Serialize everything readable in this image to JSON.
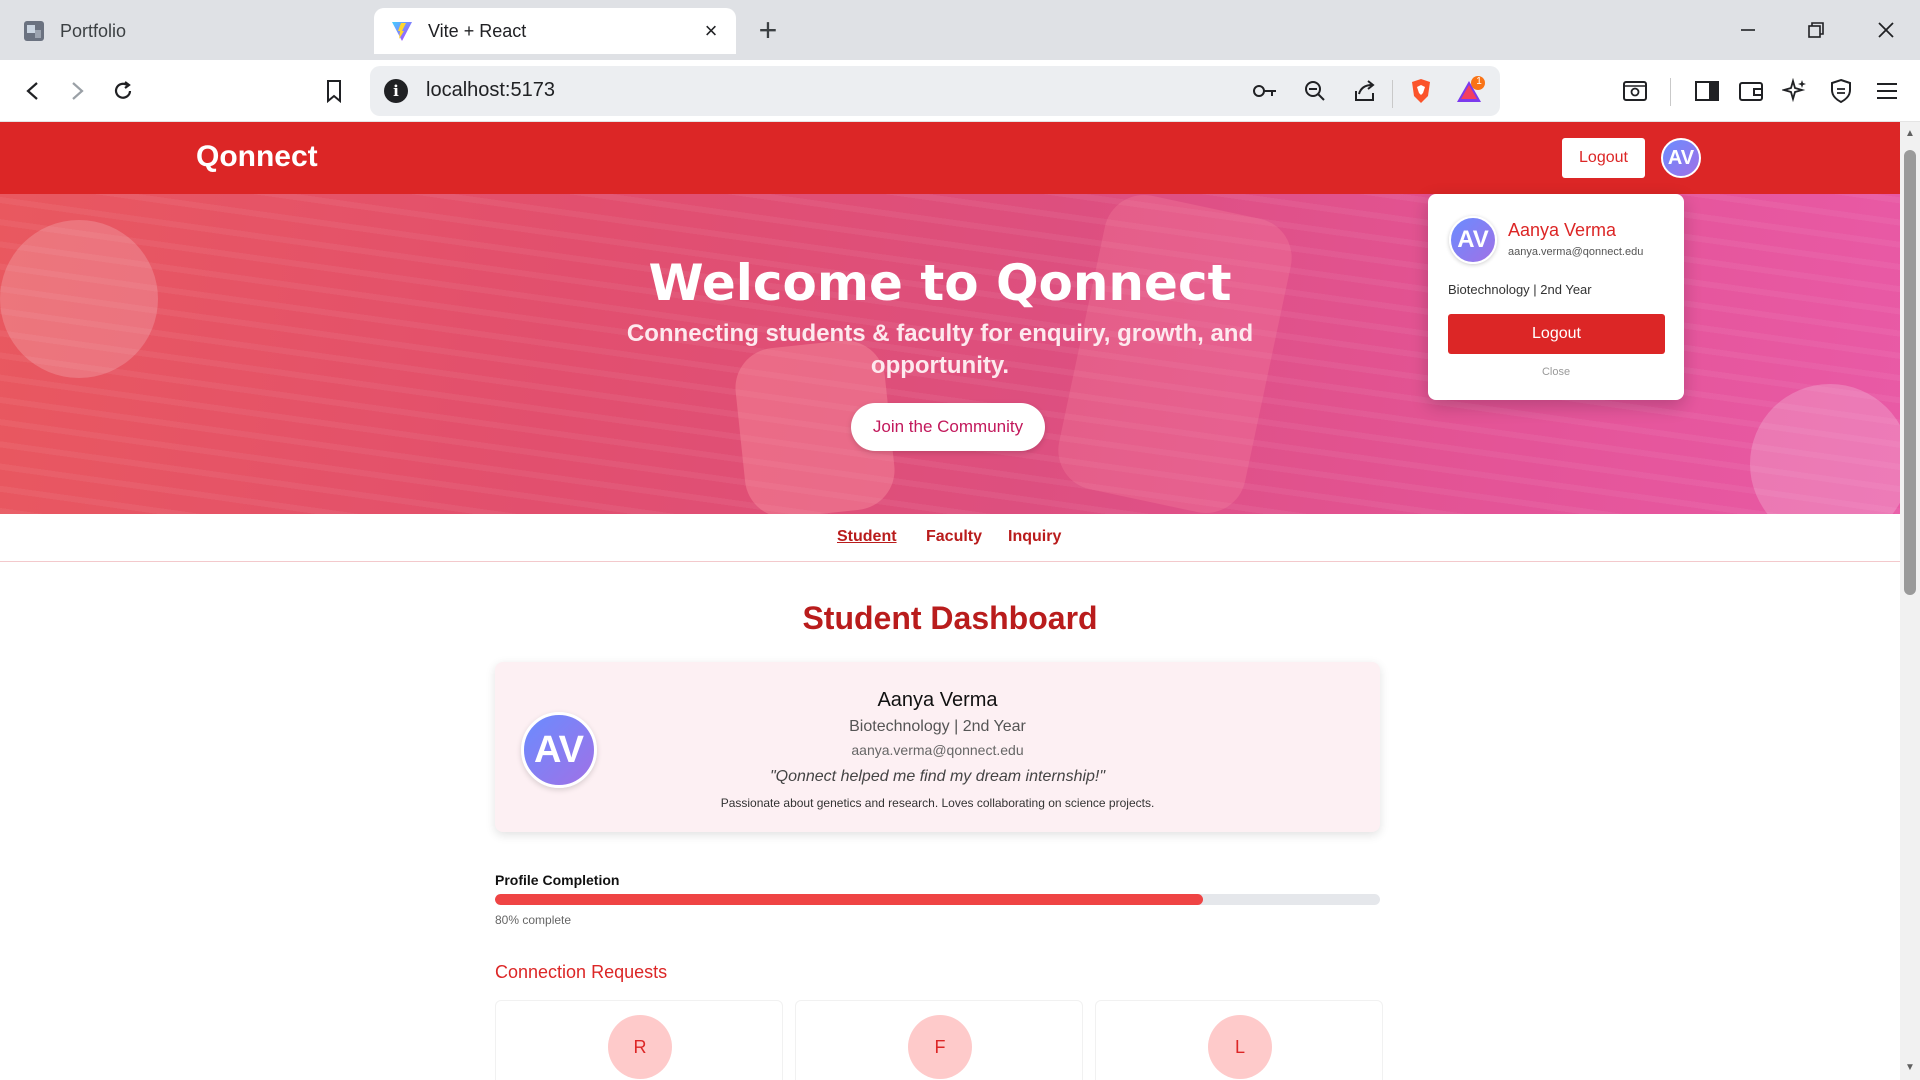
{
  "browser": {
    "tabs": [
      {
        "title": "Portfolio",
        "active": false
      },
      {
        "title": "Vite + React",
        "active": true
      }
    ],
    "url": "localhost:5173",
    "notification_count": "1"
  },
  "site": {
    "logo": "Qonnect",
    "nav_logout": "Logout",
    "avatar_initials": "AV",
    "accent_color": "#dc2626"
  },
  "hero": {
    "title": "Welcome to Qonnect",
    "subtitle": "Connecting students & faculty for enquiry, growth, and opportunity.",
    "cta": "Join the Community"
  },
  "tabs": [
    {
      "label": "Student",
      "active": true
    },
    {
      "label": "Faculty",
      "active": false
    },
    {
      "label": "Inquiry",
      "active": false
    }
  ],
  "dashboard": {
    "title": "Student Dashboard",
    "profile": {
      "initials": "AV",
      "name": "Aanya Verma",
      "dept": "Biotechnology | 2nd Year",
      "email": "aanya.verma@qonnect.edu",
      "quote": "\"Qonnect helped me find my dream internship!\"",
      "bio": "Passionate about genetics and research. Loves collaborating on science projects."
    },
    "completion": {
      "label": "Profile Completion",
      "percent": 80,
      "text": "80% complete"
    },
    "connections": {
      "title": "Connection Requests",
      "items": [
        {
          "initial": "R"
        },
        {
          "initial": "F"
        },
        {
          "initial": "L"
        }
      ]
    }
  },
  "dropdown": {
    "initials": "AV",
    "name": "Aanya Verma",
    "email": "aanya.verma@qonnect.edu",
    "dept": "Biotechnology | 2nd Year",
    "logout": "Logout",
    "close": "Close"
  }
}
